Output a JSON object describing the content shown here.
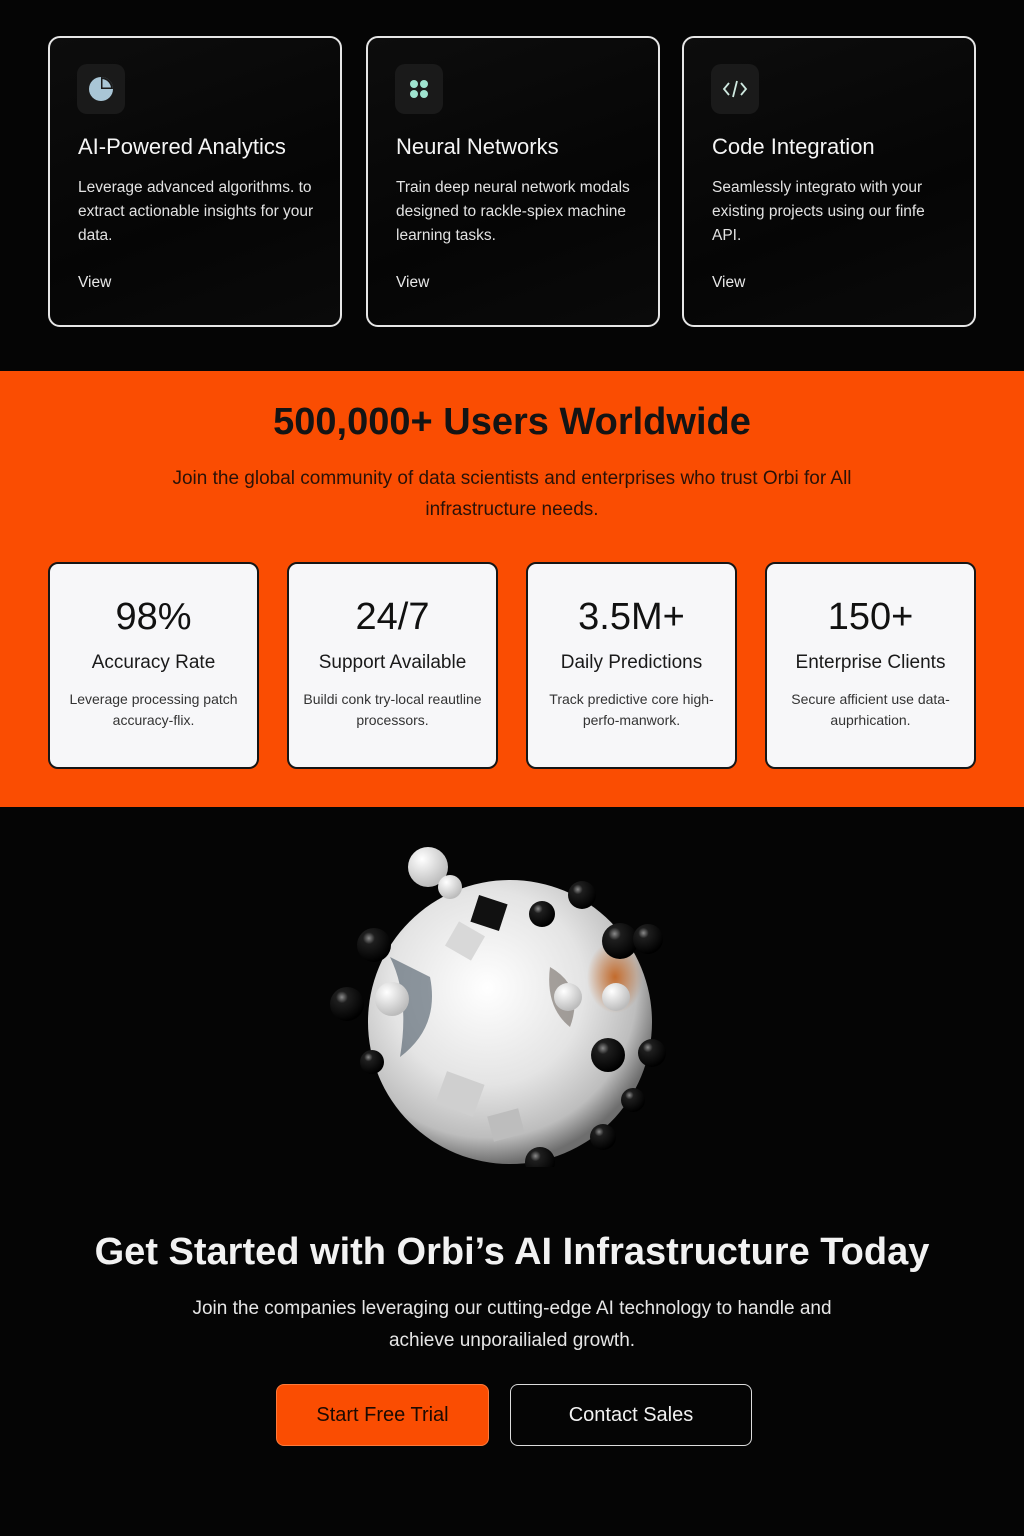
{
  "features": [
    {
      "icon": "pie-chart-icon",
      "title": "AI-Powered Analytics",
      "desc": "Leverage advanced algorithms. to extract actionable insights for your data.",
      "link": "View"
    },
    {
      "icon": "grid-dots-icon",
      "title": "Neural Networks",
      "desc": "Train deep neural network modals designed to rackle-spiex machine learning tasks.",
      "link": "View"
    },
    {
      "icon": "code-icon",
      "title": "Code Integration",
      "desc": "Seamlessly integrato with your existing projects using our finfe API.",
      "link": "View"
    }
  ],
  "stats": {
    "title": "500,000+ Users Worldwide",
    "subtitle": "Join the global community of data scientists and enterprises who trust Orbi for All infrastructure needs.",
    "items": [
      {
        "value": "98%",
        "label": "Accuracy Rate",
        "desc": "Leverage processing patch accuracy-flix."
      },
      {
        "value": "24/7",
        "label": "Support Available",
        "desc": "Buildi conk try-local reautline processors."
      },
      {
        "value": "3.5M+",
        "label": "Daily Predictions",
        "desc": "Track predictive core high-perfo-manwork."
      },
      {
        "value": "150+",
        "label": "Enterprise Clients",
        "desc": "Secure afficient use data-auprhication."
      }
    ]
  },
  "cta": {
    "title": "Get Started with Orbi’s AI Infrastructure Today",
    "subtitle": "Join the companies leveraging our cutting-edge AI technology to handle and achieve unporailialed growth.",
    "primary_button": "Start Free Trial",
    "secondary_button": "Contact Sales"
  },
  "colors": {
    "accent": "#fa4d02",
    "background": "#050505",
    "icon_tint": "#9fd8c8"
  }
}
